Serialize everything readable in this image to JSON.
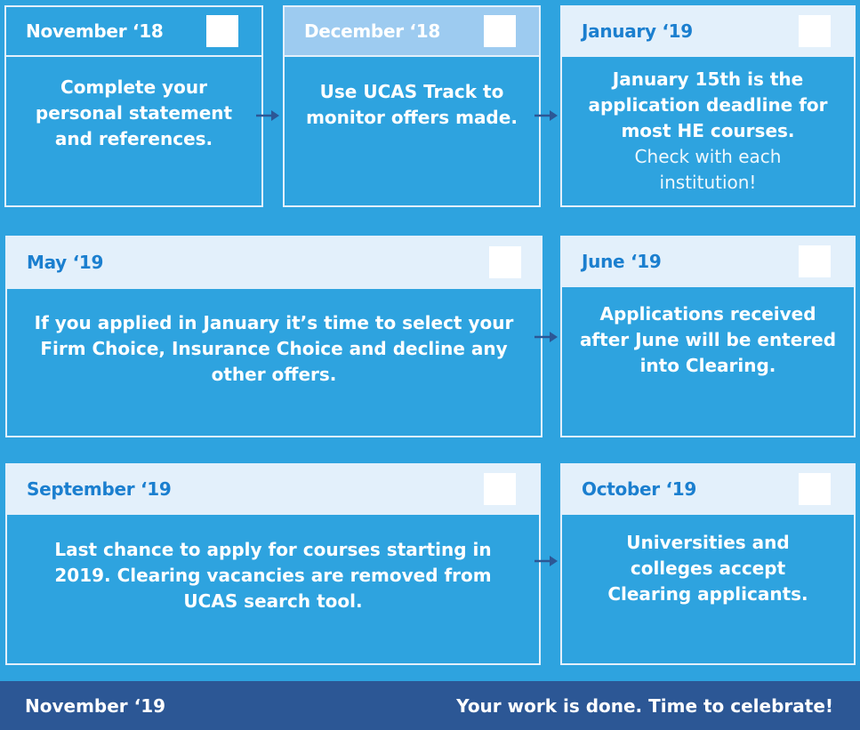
{
  "timeline": [
    {
      "month": "November ‘18",
      "text": "Complete your personal statement and references.",
      "subtext": ""
    },
    {
      "month": "December ‘18",
      "text": "Use UCAS Track to monitor offers made.",
      "subtext": ""
    },
    {
      "month": "January ‘19",
      "text": "January 15th is the application deadline for most HE courses.",
      "subtext": "Check with each institution!"
    },
    {
      "month": "May ‘19",
      "text": "If you applied in January it’s time to select your Firm Choice, Insurance Choice and decline any other offers.",
      "subtext": ""
    },
    {
      "month": "June ‘19",
      "text": "Applications received after June will be entered into Clearing.",
      "subtext": ""
    },
    {
      "month": "September ‘19",
      "text": "Last chance to apply for courses starting in 2019. Clearing vacancies are removed from UCAS search tool.",
      "subtext": ""
    },
    {
      "month": "October ‘19",
      "text": "Universities and colleges accept Clearing applicants.",
      "subtext": ""
    }
  ],
  "footer": {
    "month": "November ‘19",
    "message": "Your work is done. Time to celebrate!"
  },
  "colors": {
    "background": "#2ea3df",
    "panel_light": "#e3f0fb",
    "header_mid": "#9dcbf0",
    "accent_text": "#1b7fcf",
    "footer_bg": "#2c5795",
    "arrow": "#2c5795"
  }
}
